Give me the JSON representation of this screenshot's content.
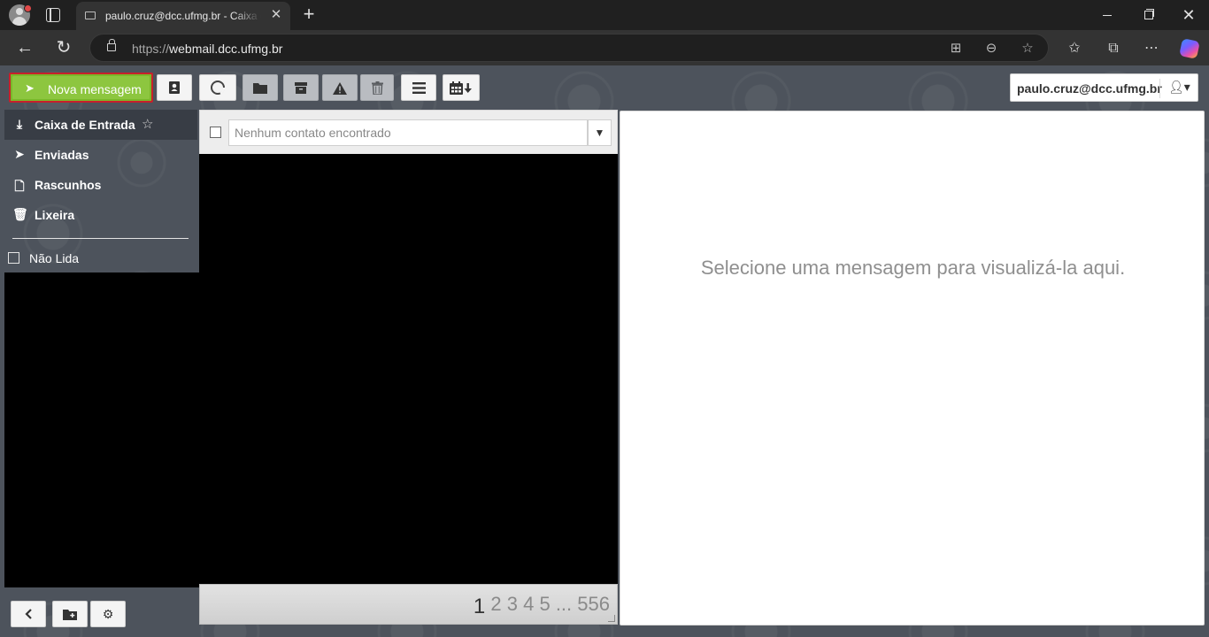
{
  "browser": {
    "tab_title": "paulo.cruz@dcc.ufmg.br - Caixa de Entrada",
    "url_protocol": "https://",
    "url_host": "webmail.dcc.ufmg.br"
  },
  "toolbar": {
    "compose_label": "Nova mensagem",
    "account_label": "paulo.cruz@dcc.ufmg.br",
    "accent_color": "#8dc63f",
    "disabled_buttons": [
      "move-to-folder",
      "archive",
      "spam",
      "delete"
    ]
  },
  "folders": [
    {
      "label": "Caixa de Entrada",
      "icon": "inbox-icon",
      "active": true
    },
    {
      "label": "Enviadas",
      "icon": "send-icon"
    },
    {
      "label": "Rascunhos",
      "icon": "draft-icon"
    },
    {
      "label": "Lixeira",
      "icon": "trash-icon"
    }
  ],
  "filters": {
    "unread_label": "Não Lida"
  },
  "message_list": {
    "search_placeholder": "Nenhum contato encontrado",
    "pager": {
      "current": "1",
      "pages": [
        "2",
        "3",
        "4",
        "5"
      ],
      "ellipsis": "...",
      "last": "556"
    }
  },
  "preview": {
    "empty_message": "Selecione uma mensagem para visualizá-la aqui."
  }
}
